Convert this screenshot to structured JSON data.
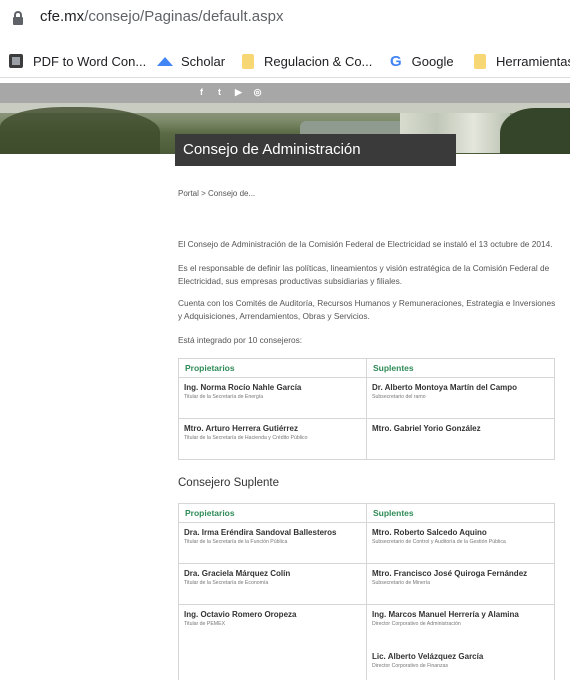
{
  "browser": {
    "url_domain": "cfe.mx",
    "url_path": "/consejo/Paginas/default.aspx",
    "bookmarks": [
      {
        "label": "PDF to Word Con...",
        "icon": "pdf-icon"
      },
      {
        "label": "Scholar",
        "icon": "scholar-icon"
      },
      {
        "label": "Regulacion & Co...",
        "icon": "folder-icon"
      },
      {
        "label": "Google",
        "icon": "google-icon"
      },
      {
        "label": "Herramientas",
        "icon": "folder-icon"
      }
    ]
  },
  "social": [
    "f",
    "t",
    "▶",
    "◎"
  ],
  "page": {
    "title": "Consejo de Administración",
    "breadcrumb": "Portal > Consejo de...",
    "paragraphs": [
      "El Consejo de Administración de la Comisión Federal de Electricidad se instaló el 13 octubre de 2014.",
      "Es el responsable de definir las políticas, lineamientos y visión estratégica de la Comisión Federal de Electricidad, sus empresas productivas subsidiarias y filiales.",
      "Cuenta con los Comités de Auditoría, Recursos Humanos y Remuneraciones, Estrategia e Inversiones y Adquisiciones, Arrendamientos, Obras y Servicios.",
      "Está integrado por 10 consejeros:"
    ],
    "table1": {
      "headers": [
        "Propietarios",
        "Suplentes"
      ],
      "rows": [
        [
          {
            "name": "Ing. Norma Rocío Nahle García",
            "role": "Titular de la Secretaría de Energía"
          },
          {
            "name": "Dr. Alberto Montoya Martín del Campo",
            "role": "Subsecretario del ramo"
          }
        ],
        [
          {
            "name": "Mtro. Arturo Herrera Gutiérrez",
            "role": "Titular de la Secretaría de Hacienda y Crédito Público"
          },
          {
            "name": "Mtro. Gabriel Yorio González",
            "role": ""
          }
        ]
      ]
    },
    "subtitle2": "Consejero Suplente",
    "table2": {
      "headers": [
        "Propietarios",
        "Suplentes"
      ],
      "rows": [
        [
          {
            "name": "Dra. Irma Eréndira Sandoval Ballesteros",
            "role": "Titular de la Secretaría de la Función Pública"
          },
          {
            "name": "Mtro. Roberto Salcedo Aquino",
            "role": "Subsecretario de Control y Auditoría de la Gestión Pública"
          }
        ],
        [
          {
            "name": "Dra. Graciela Márquez Colín",
            "role": "Titular de la Secretaría de Economía"
          },
          {
            "name": "Mtro. Francisco José Quiroga Fernández",
            "role": "Subsecretario de Minería"
          }
        ],
        [
          {
            "name": "Ing. Octavio Romero Oropeza",
            "role": "Titular de PEMEX"
          },
          {
            "name": "Ing. Marcos Manuel Herrería y Alamina",
            "role": "Director Corporativo de Administración",
            "name2": "Lic. Alberto Velázquez García",
            "role2": "Director Corporativo de Finanzas"
          }
        ]
      ]
    }
  }
}
